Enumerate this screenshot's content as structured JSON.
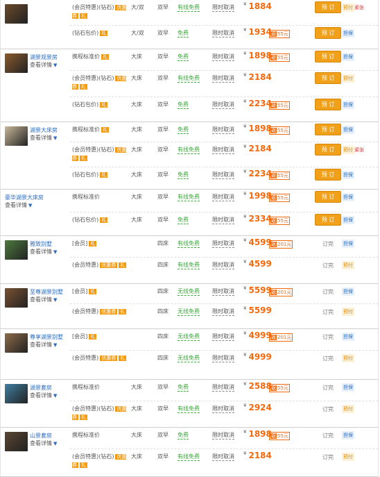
{
  "labels": {
    "book": "预 订",
    "detail": "查看详情",
    "free": "免费",
    "fixed": "双早",
    "bed_king": "大床",
    "bed_double_twin": "大/双",
    "bed_suite": "四床",
    "cancel": "限时取消",
    "soldout": "订完",
    "pay_guarantee": "担保",
    "pay_prepaid": "预付",
    "few_left": "紧张",
    "tag_member": "优惠券",
    "tag_gift": "礼",
    "wifi_free": "有线免费",
    "wifi_none": "无线免费"
  },
  "colors": {
    "accent": "#f06a0f",
    "book": "#f0a019",
    "link": "#2a6bbf",
    "green": "#3ea83e"
  },
  "rooms": [
    {
      "name": "",
      "thumb": "#6b4a2a",
      "height": 70,
      "no_name": true,
      "rates": [
        {
          "plan": "(会员特惠)(钻石)",
          "tag1": "优惠券",
          "tag2": "礼",
          "bed": "大/双",
          "bf": "双早",
          "wifi": "有线免费",
          "cancel": "限时取消",
          "price": "1884",
          "save": "",
          "action": "book",
          "pay": "预付",
          "pay_type": "b",
          "few": "紧张",
          "h": 36
        },
        {
          "plan": "(钻石包价)",
          "tag2": "礼",
          "bed": "大/双",
          "bf": "双早",
          "wifi": "免费",
          "cancel": "限时取消",
          "price": "1934",
          "save": "55元",
          "action": "book",
          "pay": "担保",
          "pay_type": "a",
          "h": 34
        }
      ]
    },
    {
      "name": "湖景观景房",
      "thumb": "#8a5b2d",
      "height": 104,
      "rates": [
        {
          "plan": "携程标准价",
          "tag2": "礼",
          "bed": "大床",
          "bf": "双早",
          "wifi": "免费",
          "cancel": "限时取消",
          "price": "1898",
          "save": "55元",
          "action": "book",
          "pay": "担保",
          "pay_type": "a",
          "h": 30
        },
        {
          "plan": "(会员特惠)(钻石)",
          "tag1": "优惠券",
          "tag2": "礼",
          "bed": "大床",
          "bf": "双早",
          "wifi": "有线免费",
          "cancel": "限时取消",
          "price": "2184",
          "save": "",
          "action": "book",
          "pay": "预付",
          "pay_type": "b",
          "h": 38
        },
        {
          "plan": "(钻石包价)",
          "tag2": "礼",
          "bed": "大床",
          "bf": "双早",
          "wifi": "免费",
          "cancel": "限时取消",
          "price": "2234",
          "save": "55元",
          "action": "book",
          "pay": "担保",
          "pay_type": "a",
          "h": 36
        }
      ]
    },
    {
      "name": "湖景大床房",
      "thumb": "#c9b89a",
      "height": 96,
      "rates": [
        {
          "plan": "携程标准价",
          "tag2": "礼",
          "bed": "大床",
          "bf": "双早",
          "wifi": "免费",
          "cancel": "限时取消",
          "price": "1898",
          "save": "55元",
          "action": "book",
          "pay": "担保",
          "pay_type": "a",
          "h": 28
        },
        {
          "plan": "(会员特惠)(钻石)",
          "tag1": "优惠券",
          "tag2": "礼",
          "bed": "大床",
          "bf": "双早",
          "wifi": "有线免费",
          "cancel": "限时取消",
          "price": "2184",
          "save": "",
          "action": "book",
          "pay": "预付",
          "pay_type": "b",
          "few": "紧张",
          "h": 36
        },
        {
          "plan": "(钻石包价)",
          "tag2": "礼",
          "bed": "大床",
          "bf": "双早",
          "wifi": "免费",
          "cancel": "限时取消",
          "price": "2234",
          "save": "55元",
          "action": "book",
          "pay": "担保",
          "pay_type": "a",
          "h": 32
        }
      ]
    },
    {
      "name": "豪华湖景大床房",
      "thumb": "",
      "height": 66,
      "no_img": true,
      "rates": [
        {
          "plan": "携程标准价",
          "bed": "大床",
          "bf": "双早",
          "wifi": "有线免费",
          "cancel": "限时取消",
          "price": "1998",
          "save": "55元",
          "action": "book",
          "pay": "担保",
          "pay_type": "a",
          "h": 32
        },
        {
          "plan": "(钻石包价)",
          "tag2": "礼",
          "bed": "大床",
          "bf": "双早",
          "wifi": "免费",
          "cancel": "限时取消",
          "price": "2334",
          "save": "55元",
          "action": "book",
          "pay": "担保",
          "pay_type": "a",
          "h": 34
        }
      ]
    },
    {
      "name": "雅致别墅",
      "thumb": "#4e7a3e",
      "height": 68,
      "rates": [
        {
          "plan": "[会员]",
          "tag2": "礼",
          "bed": "",
          "bf": "四床",
          "wifi": "有线免费",
          "cancel": "限时取消",
          "price": "4599",
          "save": "201元",
          "action": "soldout",
          "pay": "担保",
          "pay_type": "a",
          "h": 30
        },
        {
          "plan": "(会员特惠)",
          "tag1": "优惠券",
          "tag2": "礼",
          "bed": "",
          "bf": "四床",
          "wifi": "有线免费",
          "cancel": "限时取消",
          "price": "4599",
          "save": "",
          "action": "soldout",
          "pay": "预付",
          "pay_type": "b",
          "h": 38
        }
      ]
    },
    {
      "name": "至尊湖景别墅",
      "thumb": "#7a5232",
      "height": 64,
      "rates": [
        {
          "plan": "[会员]",
          "tag2": "礼",
          "bed": "",
          "bf": "四床",
          "wifi": "无线免费",
          "cancel": "限时取消",
          "price": "5599",
          "save": "201元",
          "action": "soldout",
          "pay": "担保",
          "pay_type": "a",
          "h": 28
        },
        {
          "plan": "(会员特惠)",
          "tag1": "优惠券",
          "tag2": "礼",
          "bed": "",
          "bf": "四床",
          "wifi": "无线免费",
          "cancel": "限时取消",
          "price": "5599",
          "save": "",
          "action": "soldout",
          "pay": "预付",
          "pay_type": "b",
          "h": 36
        }
      ]
    },
    {
      "name": "尊享湖景别墅",
      "thumb": "#8c6b4a",
      "height": 72,
      "rates": [
        {
          "plan": "[会员]",
          "tag2": "礼",
          "bed": "",
          "bf": "四床",
          "wifi": "无线免费",
          "cancel": "限时取消",
          "price": "4999",
          "save": "201元",
          "action": "soldout",
          "pay": "担保",
          "pay_type": "a",
          "h": 30
        },
        {
          "plan": "(会员特惠)",
          "tag1": "优惠券",
          "tag2": "礼",
          "bed": "",
          "bf": "四床",
          "wifi": "无线免费",
          "cancel": "限时取消",
          "price": "4999",
          "save": "",
          "action": "soldout",
          "pay": "预付",
          "pay_type": "b",
          "h": 42
        }
      ]
    },
    {
      "name": "湖景套房",
      "thumb": "#3f7ea0",
      "height": 68,
      "rates": [
        {
          "plan": "携程标准价",
          "bed": "大床",
          "bf": "双早",
          "wifi": "免费",
          "cancel": "限时取消",
          "price": "2588",
          "save": "55元",
          "action": "soldout",
          "pay": "担保",
          "pay_type": "a",
          "h": 30
        },
        {
          "plan": "(会员特惠)(钻石)",
          "tag1": "优惠券",
          "tag2": "礼",
          "bed": "大床",
          "bf": "双早",
          "wifi": "有线免费",
          "cancel": "限时取消",
          "price": "2924",
          "save": "",
          "action": "soldout",
          "pay": "预付",
          "pay_type": "b",
          "h": 38
        }
      ]
    },
    {
      "name": "山景套房",
      "thumb": "#5a4632",
      "height": 70,
      "rates": [
        {
          "plan": "携程标准价",
          "bed": "大床",
          "bf": "双早",
          "wifi": "免费",
          "cancel": "限时取消",
          "price": "1898",
          "save": "55元",
          "action": "soldout",
          "pay": "担保",
          "pay_type": "a",
          "h": 30
        },
        {
          "plan": "(会员特惠)(钻石)",
          "tag1": "优惠券",
          "tag2": "礼",
          "bed": "大床",
          "bf": "双早",
          "wifi": "有线免费",
          "cancel": "限时取消",
          "price": "2184",
          "save": "",
          "action": "soldout",
          "pay": "预付",
          "pay_type": "b",
          "h": 40
        }
      ]
    }
  ]
}
